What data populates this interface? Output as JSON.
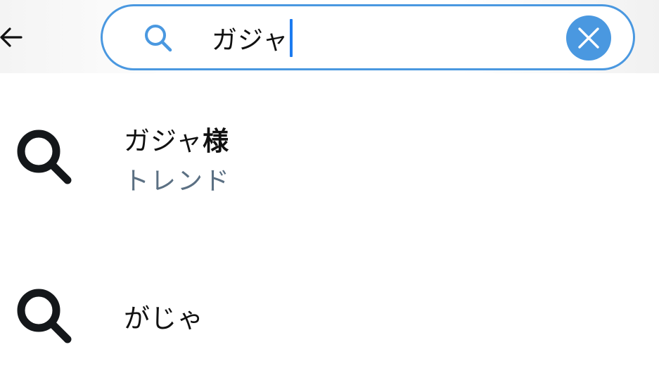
{
  "header": {
    "back_icon": "arrow-left-icon",
    "search": {
      "icon": "search-icon",
      "value": "ガジャ",
      "clear_icon": "close-icon",
      "accent_color": "#4a98e0"
    }
  },
  "suggestions": [
    {
      "icon": "search-icon",
      "title_prefix": "ガジャ",
      "title_highlight": "様",
      "subtitle": "トレンド"
    },
    {
      "icon": "search-icon",
      "title_prefix": "がじゃ",
      "title_highlight": "",
      "subtitle": ""
    }
  ]
}
